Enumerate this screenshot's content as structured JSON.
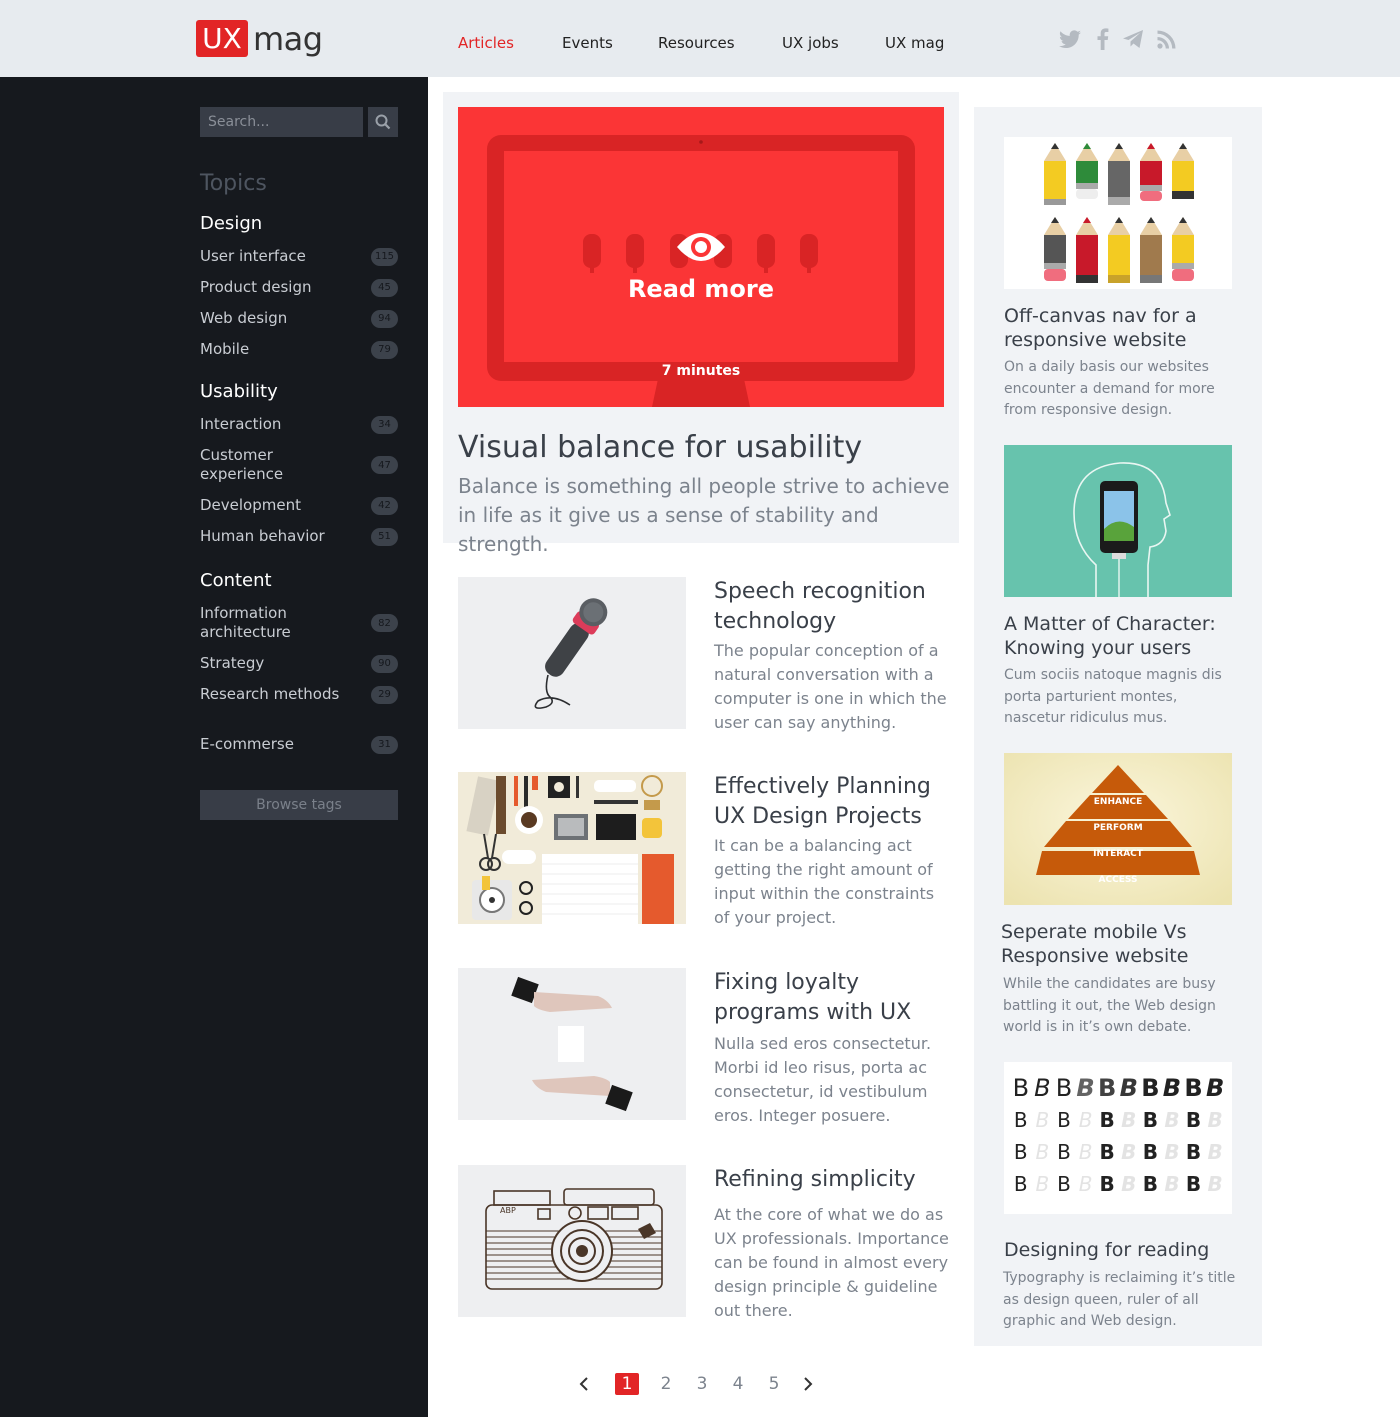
{
  "header": {
    "logo_ux": "UX",
    "logo_mag": "mag",
    "nav": [
      "Articles",
      "Events",
      "Resources",
      "UX jobs",
      "UX mag"
    ],
    "active_nav": "Articles",
    "social_icons": [
      "twitter-icon",
      "facebook-icon",
      "telegram-icon",
      "rss-icon"
    ]
  },
  "sidebar": {
    "search_placeholder": "Search...",
    "topics_heading": "Topics",
    "groups": [
      {
        "title": "Design",
        "items": [
          {
            "label": "User interface",
            "count": "115"
          },
          {
            "label": "Product design",
            "count": "45"
          },
          {
            "label": "Web design",
            "count": "94"
          },
          {
            "label": "Mobile",
            "count": "79"
          }
        ]
      },
      {
        "title": "Usability",
        "items": [
          {
            "label": "Interaction",
            "count": "34"
          },
          {
            "label": "Customer experience",
            "count": "47"
          },
          {
            "label": "Development",
            "count": "42"
          },
          {
            "label": "Human behavior",
            "count": "51"
          }
        ]
      },
      {
        "title": "Content",
        "items": [
          {
            "label": "Information architecture",
            "count": "82"
          },
          {
            "label": "Strategy",
            "count": "90"
          },
          {
            "label": "Research methods",
            "count": "29"
          },
          {
            "label": "E-commerse",
            "count": "31"
          }
        ]
      }
    ],
    "browse_tags": "Browse tags"
  },
  "featured": {
    "read_more": "Read more",
    "duration": "7 minutes",
    "title": "Visual balance for usability",
    "description": "Balance is something all people strive to achieve in life as it give us a sense of stability and strength."
  },
  "articles": [
    {
      "title": "Speech recognition technology",
      "description": "The popular conception of a natural conversation with a computer is one in which the user can say anything.",
      "thumb": "microphone"
    },
    {
      "title": "Effectively Planning UX Design Projects",
      "description": "It can be a balancing act getting the right amount of input within the constraints of your project.",
      "thumb": "desk-flatlay"
    },
    {
      "title": "Fixing loyalty programs with UX",
      "description": "Nulla sed eros consectetur. Morbi id leo risus, porta ac consectetur, id vestibulum eros. Integer posuere.",
      "thumb": "hands-card"
    },
    {
      "title": "Refining simplicity",
      "description": "At the core of what we do as UX professionals. Importance can be found in almost every design principle & guideline out there.",
      "thumb": "camera"
    }
  ],
  "right_cards": [
    {
      "title": "Off-canvas nav for a responsive website",
      "description": "On a daily basis our websites encounter a demand for more from responsive design.",
      "thumb": "pencils"
    },
    {
      "title": "A Matter of Character: Knowing your users",
      "description": "Cum sociis natoque magnis dis porta parturient montes, nascetur ridiculus mus.",
      "thumb": "head-phone"
    },
    {
      "title": "Seperate mobile Vs Responsive website",
      "description": "While the candidates are busy battling it out, the Web design world is in it’s own debate.",
      "thumb": "pyramid",
      "pyramid_labels": [
        "ENHANCE",
        "PERFORM",
        "INTERACT",
        "ACCESS"
      ]
    },
    {
      "title": "Designing for reading",
      "description": "Typography is reclaiming it’s title as design queen, ruler of all graphic and Web design.",
      "thumb": "typography",
      "glyph": "B"
    }
  ],
  "pagination": {
    "pages": [
      "1",
      "2",
      "3",
      "4",
      "5"
    ],
    "current": "1"
  },
  "colors": {
    "accent": "#e22526",
    "sidebar_bg": "#16191e",
    "header_bg": "#e7ebef",
    "card_bg": "#f1f3f6"
  }
}
